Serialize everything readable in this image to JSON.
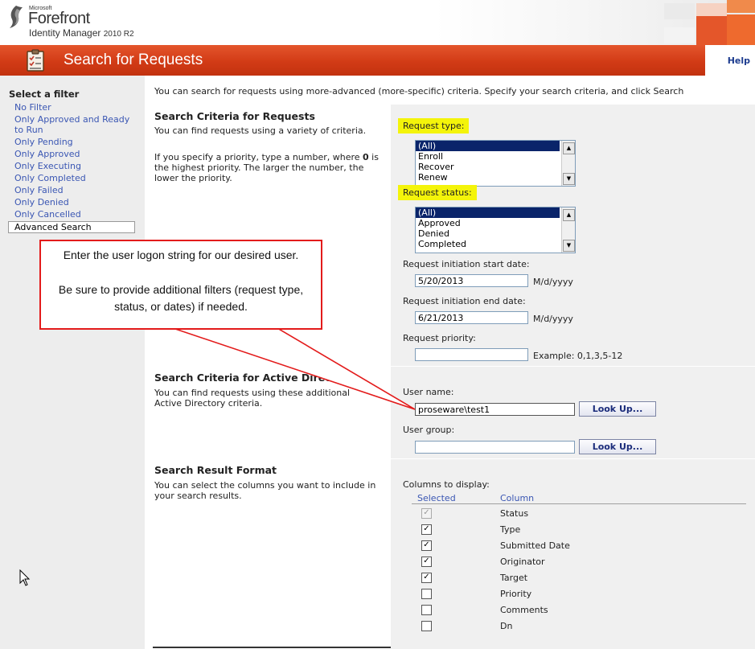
{
  "brand": {
    "microsoft": "Microsoft",
    "product": "Forefront",
    "subproduct": "Identity Manager",
    "version": "2010 R2"
  },
  "header": {
    "title": "Search for Requests",
    "help": "Help"
  },
  "sidebar": {
    "heading": "Select a filter",
    "items": [
      "No Filter",
      "Only Approved and Ready to Run",
      "Only Pending",
      "Only Approved",
      "Only Executing",
      "Only Completed",
      "Only Failed",
      "Only Denied",
      "Only Cancelled",
      "Advanced Search"
    ],
    "active_index": 9
  },
  "main": {
    "intro": "You can search for requests using more-advanced (more-specific) criteria. Specify your search criteria, and click Search",
    "requests_section": {
      "heading": "Search Criteria for Requests",
      "desc1": "You can find requests using a variety of criteria.",
      "desc2_pre": "If you specify a priority, type a number, where ",
      "desc2_bold": "0",
      "desc2_post": " is the highest priority. The larger the number, the lower the priority."
    },
    "ad_section": {
      "heading": "Search Criteria for Active Directory",
      "desc": "You can find requests using these additional Active Directory criteria."
    },
    "result_section": {
      "heading": "Search Result Format",
      "desc": "You can select the columns you want to include in your search results."
    }
  },
  "form": {
    "request_type": {
      "label": "Request type:",
      "options": [
        "(All)",
        "Enroll",
        "Recover",
        "Renew"
      ],
      "selected": 0
    },
    "request_status": {
      "label": "Request status:",
      "options": [
        "(All)",
        "Approved",
        "Denied",
        "Completed"
      ],
      "selected": 0
    },
    "start_date": {
      "label": "Request initiation start date:",
      "value": "5/20/2013",
      "format": "M/d/yyyy"
    },
    "end_date": {
      "label": "Request initiation end date:",
      "value": "6/21/2013",
      "format": "M/d/yyyy"
    },
    "priority": {
      "label": "Request priority:",
      "value": "",
      "example": "Example: 0,1,3,5-12"
    },
    "user_name": {
      "label": "User name:",
      "value": "proseware\\test1",
      "button": "Look Up..."
    },
    "user_group": {
      "label": "User group:",
      "value": "",
      "button": "Look Up..."
    },
    "columns": {
      "label": "Columns to display:",
      "head_selected": "Selected",
      "head_column": "Column",
      "rows": [
        {
          "name": "Status",
          "checked": true,
          "disabled": true
        },
        {
          "name": "Type",
          "checked": true,
          "disabled": false
        },
        {
          "name": "Submitted Date",
          "checked": true,
          "disabled": false
        },
        {
          "name": "Originator",
          "checked": true,
          "disabled": false
        },
        {
          "name": "Target",
          "checked": true,
          "disabled": false
        },
        {
          "name": "Priority",
          "checked": false,
          "disabled": false
        },
        {
          "name": "Comments",
          "checked": false,
          "disabled": false
        },
        {
          "name": "Dn",
          "checked": false,
          "disabled": false
        }
      ]
    }
  },
  "callout": {
    "line1": "Enter the user logon string for our desired user.",
    "line2": "Be sure to provide additional filters (request type, status, or dates) if needed."
  },
  "colors": {
    "title_bar": "#d23b16",
    "highlight": "#f4f40a",
    "link": "#3a56b3",
    "callout_border": "#e31b1b"
  }
}
